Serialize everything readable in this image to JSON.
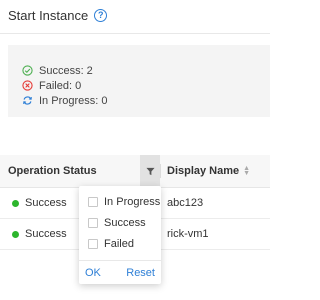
{
  "header": {
    "title": "Start Instance",
    "help_icon": "question-circle-icon"
  },
  "summary": {
    "items": [
      {
        "label": "Success: 2",
        "icon": "check-circle-icon",
        "color": "#4caf50"
      },
      {
        "label": "Failed: 0",
        "icon": "x-circle-icon",
        "color": "#e53935"
      },
      {
        "label": "In Progress: 0",
        "icon": "refresh-icon",
        "color": "#2e7fd6"
      }
    ]
  },
  "table": {
    "columns": {
      "status": "Operation Status",
      "name": "Display Name"
    },
    "rows": [
      {
        "status": "Success",
        "name": "abc123"
      },
      {
        "status": "Success",
        "name": "rick-vm1"
      }
    ],
    "status_color": "#2cb52c"
  },
  "filter_dropdown": {
    "options": [
      "In Progress",
      "Success",
      "Failed"
    ],
    "ok_label": "OK",
    "reset_label": "Reset"
  },
  "colors": {
    "accent": "#2e7fd6"
  }
}
